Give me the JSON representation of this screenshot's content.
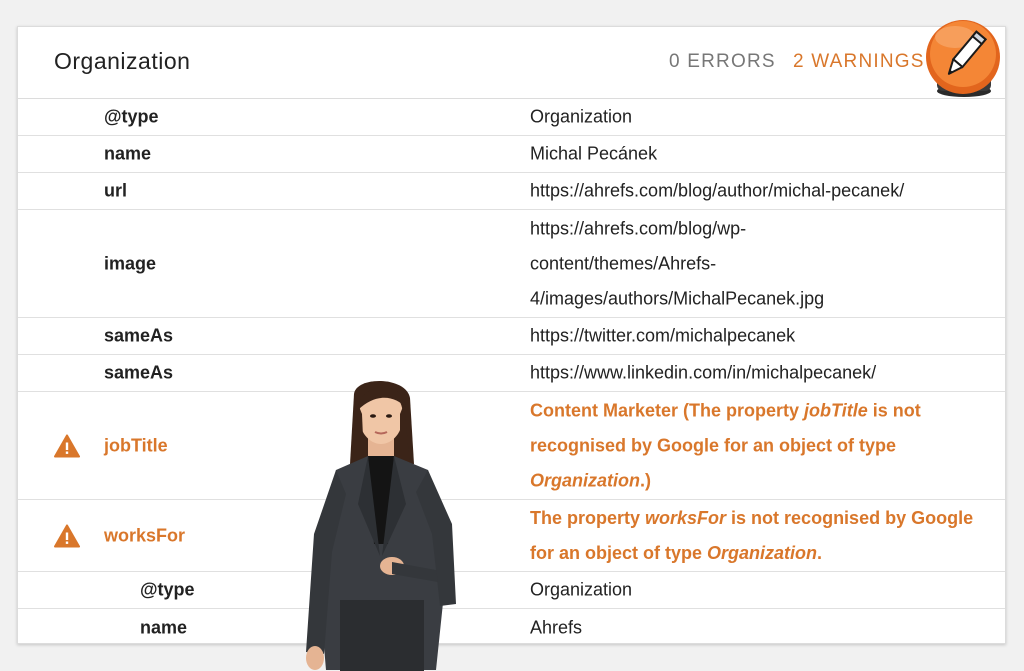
{
  "header": {
    "title": "Organization",
    "errors_label": "0 ERRORS",
    "warnings_label": "2 WARNINGS"
  },
  "rows": [
    {
      "key": "@type",
      "value": "Organization"
    },
    {
      "key": "name",
      "value": "Michal Pecánek"
    },
    {
      "key": "url",
      "value": "https://ahrefs.com/blog/author/michal-pecanek/"
    },
    {
      "key": "image",
      "value_lines": [
        "https://ahrefs.com/blog/wp-",
        "content/themes/Ahrefs-",
        "4/images/authors/MichalPecanek.jpg"
      ]
    },
    {
      "key": "sameAs",
      "value": "https://twitter.com/michalpecanek"
    },
    {
      "key": "sameAs",
      "value": "https://www.linkedin.com/in/michalpecanek/"
    },
    {
      "key": "jobTitle",
      "warning": true,
      "value_parts": {
        "a": "Content Marketer (The property ",
        "b": "jobTitle",
        "c": " is not recognised by Google for an object of type ",
        "d": "Organization",
        "e": ".)"
      }
    },
    {
      "key": "worksFor",
      "warning": true,
      "value_parts": {
        "a": "The property ",
        "b": "worksFor",
        "c": " is not recognised by Google for an object of type ",
        "d": "Organization",
        "e": "."
      }
    },
    {
      "key": "@type",
      "value": "Organization",
      "nested": true
    },
    {
      "key": "name",
      "value": "Ahrefs",
      "nested": true
    }
  ],
  "icons": {
    "warning": "warning-triangle-icon",
    "badge": "pencil-icon"
  },
  "colors": {
    "warning": "#d9772b",
    "badge": "#f07a2a",
    "text": "#222222",
    "muted": "#777777"
  }
}
